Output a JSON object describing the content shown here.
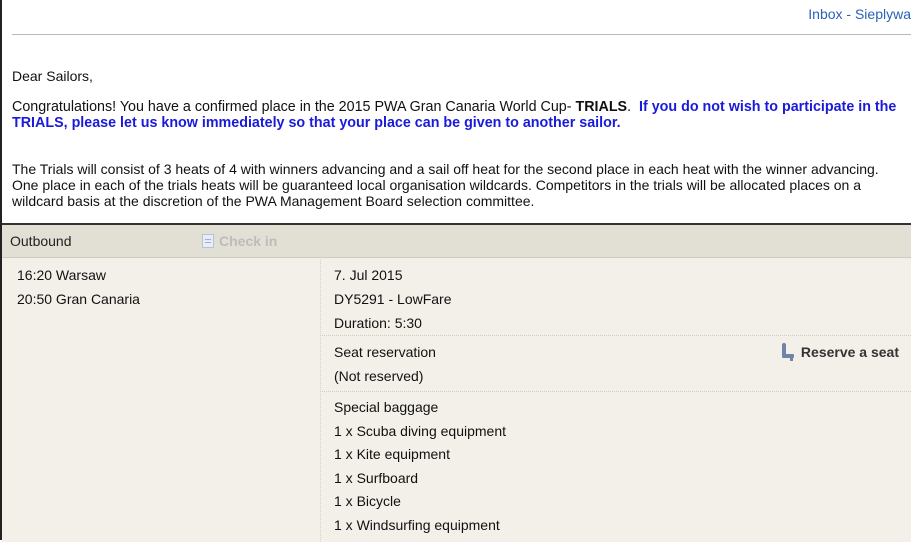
{
  "header": {
    "inbox_link": "Inbox - Sieplywa"
  },
  "email": {
    "greeting": "Dear Sailors,",
    "congrats_text": "Congratulations!  You have a confirmed place in the 2015 PWA Gran Canaria World Cup- ",
    "congrats_bold": "TRIALS",
    "congrats_period": ".  ",
    "warning": "If you do not wish to participate in the TRIALS, please let us know immediately so that your place can be given to another sailor.",
    "trials_info": "The Trials will consist of 3 heats of 4 with winners advancing and a sail off heat for the second place in each heat with the winner advancing. One place in each of the trials heats will be guaranteed local organisation wildcards. Competitors in the trials will be allocated places on a wildcard basis at the discretion of the PWA Management Board selection committee."
  },
  "flight": {
    "direction_label": "Outbound",
    "checkin_label": "Check in",
    "departure": "16:20 Warsaw",
    "arrival": "20:50 Gran Canaria",
    "date": "7. Jul 2015",
    "flight_number": "DY5291 - LowFare",
    "duration": "Duration: 5:30",
    "seat": {
      "title": "Seat reservation",
      "status": "(Not reserved)",
      "button_label": "Reserve a seat"
    },
    "baggage": {
      "title": "Special baggage",
      "items": [
        "1 x Scuba diving equipment",
        "1 x Kite equipment",
        "1 x Surfboard",
        "1 x Bicycle",
        "1 x Windsurfing equipment"
      ]
    }
  },
  "colors": {
    "link_blue": "#2a62b8",
    "warning_blue": "#1a1adb",
    "panel_bg": "#f2f0e8",
    "panel_header": "#e2dfd4"
  },
  "icons": {
    "checkin": "document-icon",
    "seat": "seat-icon"
  }
}
